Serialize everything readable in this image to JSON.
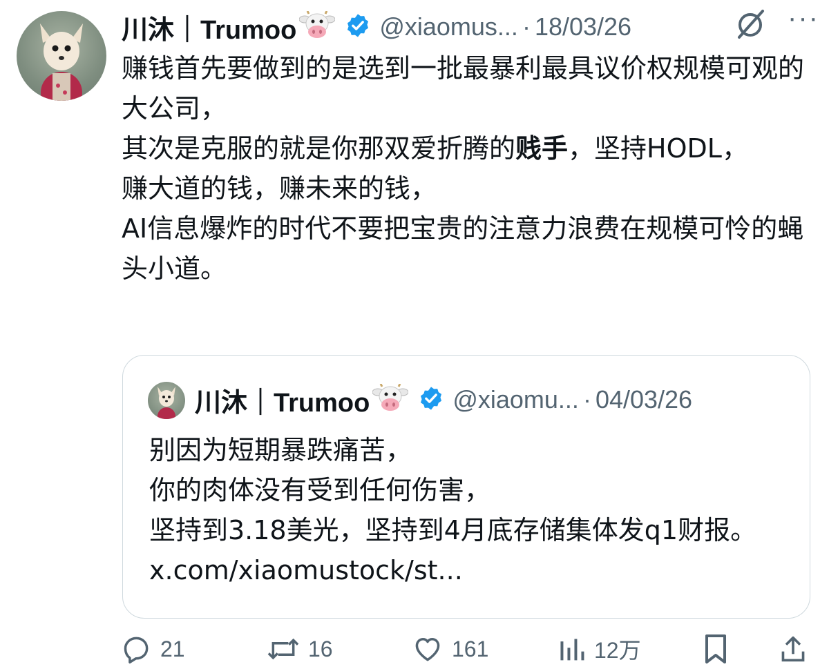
{
  "tweet": {
    "author_name": "川沐｜Trumoo",
    "author_emoji": "cow-face-emoji",
    "handle": "@xiaomus...",
    "separator": "·",
    "date": "18/03/26",
    "more_label": "···",
    "text_part1": "赚钱首先要做到的是选到一批最暴利最具议价权规模可观的大公司，\n其次是克服的就是你那双爱折腾的",
    "text_bold": "贱手",
    "text_part2": "，坚持HODL，\n赚大道的钱，赚未来的钱，\nAI信息爆炸的时代不要把宝贵的注意力浪费在规模可怜的蝇头小道。"
  },
  "quote": {
    "author_name": "川沐｜Trumoo",
    "handle": "@xiaomu...",
    "separator": "·",
    "date": "04/03/26",
    "text": "别因为短期暴跌痛苦，\n你的肉体没有受到任何伤害，\n坚持到3.18美光，坚持到4月底存储集体发q1财报。 x.com/xiaomustock/st..."
  },
  "actions": {
    "replies": "21",
    "reposts": "16",
    "likes": "161",
    "views": "12万"
  },
  "colors": {
    "text": "#0f1419",
    "secondary": "#536471",
    "verified": "#1d9bf0",
    "border": "#cfd9de"
  }
}
